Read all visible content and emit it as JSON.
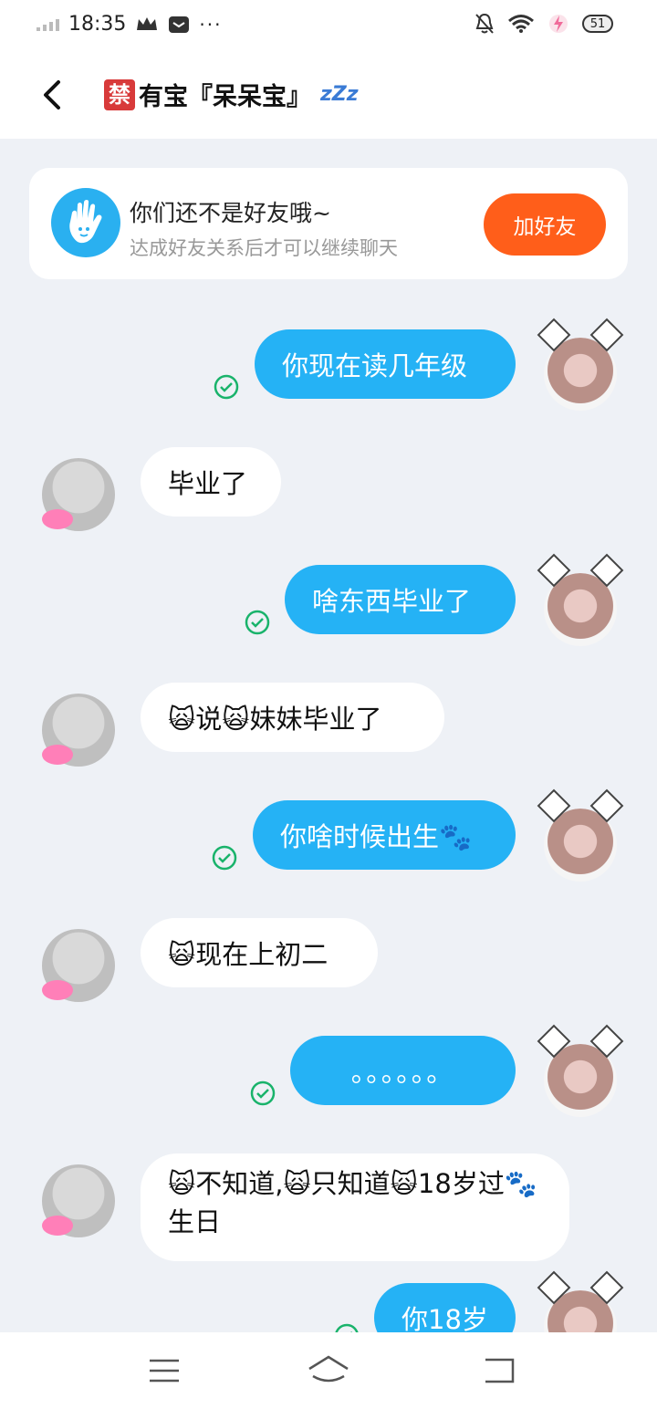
{
  "status_bar": {
    "time": "18:35",
    "battery": "51",
    "extra": "···"
  },
  "header": {
    "badge": "禁",
    "title": "有宝『呆呆宝』",
    "zzz": "zZz"
  },
  "friend_banner": {
    "title": "你们还不是好友哦~",
    "subtitle": "达成好友关系后才可以继续聊天",
    "button": "加好友"
  },
  "messages": [
    {
      "sender": "me",
      "text": "你现在读几年级",
      "status": "sent"
    },
    {
      "sender": "them",
      "text": "毕业了"
    },
    {
      "sender": "me",
      "text": "啥东西毕业了",
      "status": "sent"
    },
    {
      "sender": "them",
      "text": "🙀说🙀妹妹毕业了"
    },
    {
      "sender": "me",
      "text": "你啥时候出生🐾",
      "status": "sent"
    },
    {
      "sender": "them",
      "text": "🙀现在上初二"
    },
    {
      "sender": "me",
      "text": "。。。。。。",
      "status": "sent"
    },
    {
      "sender": "them",
      "text": "🙀不知道,🙀只知道🙀18岁过🐾生日"
    },
    {
      "sender": "me",
      "text": "你18岁",
      "status": "sent"
    }
  ],
  "colors": {
    "my_bubble": "#25b2f5",
    "their_bubble": "#ffffff",
    "add_button": "#ff5e1a",
    "sent_check": "#19b36b",
    "background": "#eef1f6"
  },
  "icons": {
    "back": "chevron-left-icon",
    "wave": "hand-wave-icon",
    "menu": "menu-icon",
    "home": "home-icon",
    "return": "back-arrow-icon"
  }
}
